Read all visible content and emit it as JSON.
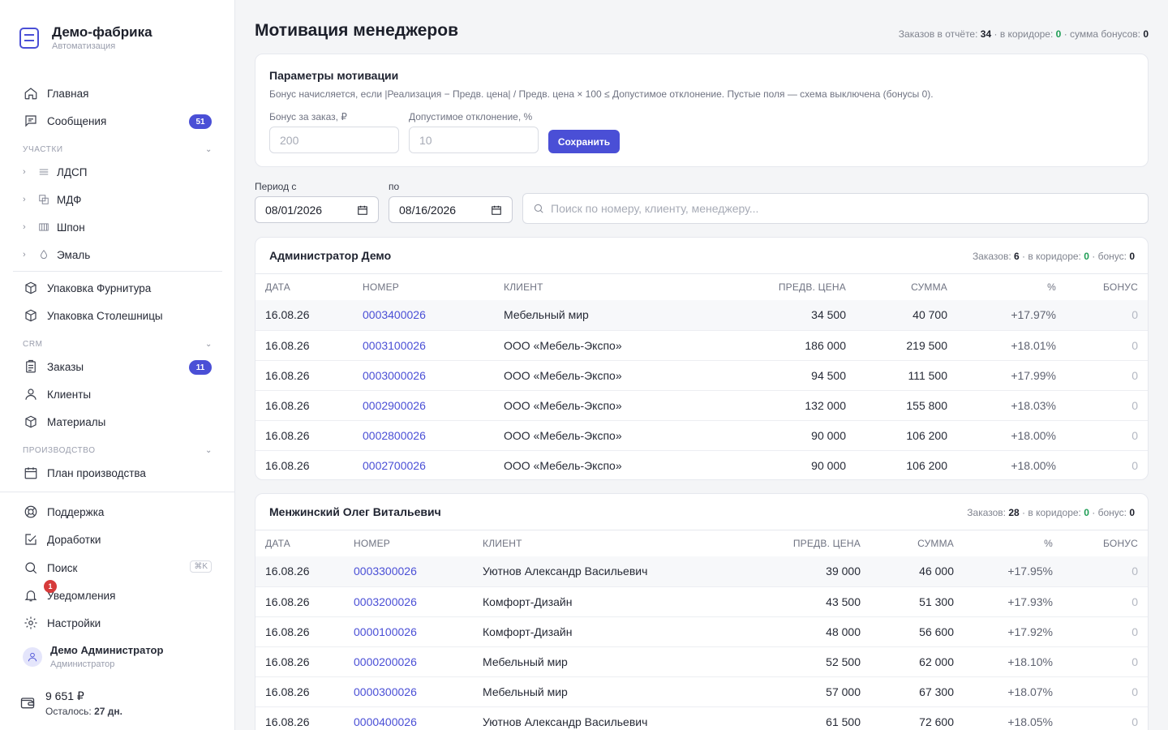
{
  "colors": {
    "accent": "#4a4fd6",
    "success": "#1f9d55",
    "danger": "#d63a3a"
  },
  "brand": {
    "name": "Демо-фабрика",
    "subtitle": "Автоматизация"
  },
  "nav": {
    "home": "Главная",
    "messages": {
      "label": "Сообщения",
      "badge": "51"
    },
    "section_sites": "УЧАСТКИ",
    "sites": [
      {
        "label": "ЛДСП",
        "icon": "stack-icon"
      },
      {
        "label": "МДФ",
        "icon": "layers-icon"
      },
      {
        "label": "Шпон",
        "icon": "grid-icon"
      },
      {
        "label": "Эмаль",
        "icon": "drop-icon"
      }
    ],
    "pack_furniture": "Упаковка Фурнитура",
    "pack_tops": "Упаковка Столешницы",
    "section_crm": "CRM",
    "orders": {
      "label": "Заказы",
      "badge": "11"
    },
    "clients": "Клиенты",
    "materials": "Материалы",
    "section_production": "ПРОИЗВОДСТВО",
    "production_plan": "План производства",
    "support": "Поддержка",
    "improvements": "Доработки",
    "search": {
      "label": "Поиск",
      "shortcut": "⌘K"
    },
    "notifications": {
      "label": "Уведомления",
      "badge": "1"
    },
    "settings": "Настройки"
  },
  "user": {
    "name": "Демо Администратор",
    "role": "Администратор"
  },
  "wallet": {
    "amount": "9 651 ₽",
    "left_label": "Осталось:",
    "left_value": "27 дн."
  },
  "page": {
    "title": "Мотивация менеджеров",
    "stats": {
      "orders_label": "Заказов в отчёте:",
      "orders": "34",
      "corridor_label": "· в коридоре:",
      "corridor": "0",
      "bonus_label": "· сумма бонусов:",
      "bonus": "0"
    }
  },
  "params": {
    "title": "Параметры мотивации",
    "description": "Бонус начисляется, если |Реализация − Предв. цена| / Предв. цена × 100 ≤ Допустимое отклонение. Пустые поля — схема выключена (бонусы 0).",
    "bonus_label": "Бонус за заказ, ₽",
    "bonus_placeholder": "200",
    "deviation_label": "Допустимое отклонение, %",
    "deviation_placeholder": "10",
    "save": "Сохранить"
  },
  "filters": {
    "from_label": "Период с",
    "from_value": "08/01/2026",
    "to_label": "по",
    "to_value": "08/16/2026",
    "search_placeholder": "Поиск по номеру, клиенту, менеджеру..."
  },
  "columns": [
    "ДАТА",
    "НОМЕР",
    "КЛИЕНТ",
    "ПРЕДВ. ЦЕНА",
    "СУММА",
    "%",
    "БОНУС"
  ],
  "groups": [
    {
      "name": "Администратор Демо",
      "orders_label": "Заказов:",
      "orders": "6",
      "corridor_label": "· в коридоре:",
      "corridor": "0",
      "bonus_label": "· бонус:",
      "bonus": "0",
      "rows": [
        [
          "16.08.26",
          "0003400026",
          "Мебельный мир",
          "34 500",
          "40 700",
          "+17.97%",
          "0"
        ],
        [
          "16.08.26",
          "0003100026",
          "ООО «Мебель-Экспо»",
          "186 000",
          "219 500",
          "+18.01%",
          "0"
        ],
        [
          "16.08.26",
          "0003000026",
          "ООО «Мебель-Экспо»",
          "94 500",
          "111 500",
          "+17.99%",
          "0"
        ],
        [
          "16.08.26",
          "0002900026",
          "ООО «Мебель-Экспо»",
          "132 000",
          "155 800",
          "+18.03%",
          "0"
        ],
        [
          "16.08.26",
          "0002800026",
          "ООО «Мебель-Экспо»",
          "90 000",
          "106 200",
          "+18.00%",
          "0"
        ],
        [
          "16.08.26",
          "0002700026",
          "ООО «Мебель-Экспо»",
          "90 000",
          "106 200",
          "+18.00%",
          "0"
        ]
      ]
    },
    {
      "name": "Менжинский Олег Витальевич",
      "orders_label": "Заказов:",
      "orders": "28",
      "corridor_label": "· в коридоре:",
      "corridor": "0",
      "bonus_label": "· бонус:",
      "bonus": "0",
      "rows": [
        [
          "16.08.26",
          "0003300026",
          "Уютнов Александр Васильевич",
          "39 000",
          "46 000",
          "+17.95%",
          "0"
        ],
        [
          "16.08.26",
          "0003200026",
          "Комфорт-Дизайн",
          "43 500",
          "51 300",
          "+17.93%",
          "0"
        ],
        [
          "16.08.26",
          "0000100026",
          "Комфорт-Дизайн",
          "48 000",
          "56 600",
          "+17.92%",
          "0"
        ],
        [
          "16.08.26",
          "0000200026",
          "Мебельный мир",
          "52 500",
          "62 000",
          "+18.10%",
          "0"
        ],
        [
          "16.08.26",
          "0000300026",
          "Мебельный мир",
          "57 000",
          "67 300",
          "+18.07%",
          "0"
        ],
        [
          "16.08.26",
          "0000400026",
          "Уютнов Александр Васильевич",
          "61 500",
          "72 600",
          "+18.05%",
          "0"
        ]
      ]
    }
  ]
}
